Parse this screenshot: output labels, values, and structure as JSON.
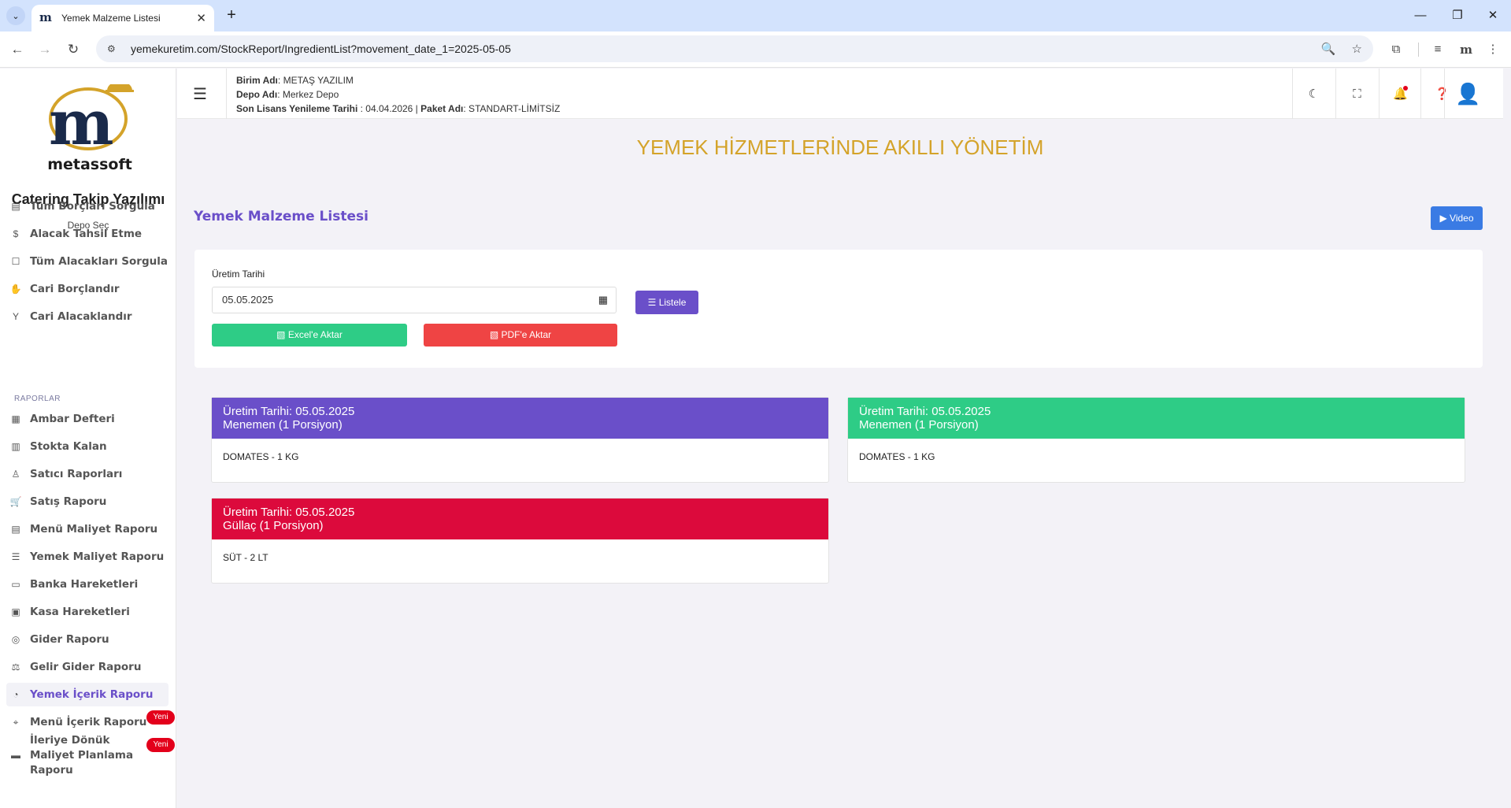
{
  "browser": {
    "tab_title": "Yemek Malzeme Listesi",
    "url": "yemekuretim.com/StockReport/IngredientList?movement_date_1=2025-05-05"
  },
  "sidebar": {
    "brand": "metassoft",
    "subtitle": "Catering Takip Yazılımı",
    "depo_select": "Depo Seç",
    "items_top": [
      {
        "label": "Tüm Borçları Sorgula",
        "icon": "receipt-icon"
      },
      {
        "label": "Alacak Tahsil Etme",
        "icon": "money-icon"
      },
      {
        "label": "Tüm Alacakları Sorgula",
        "icon": "document-icon"
      },
      {
        "label": "Cari Borçlandır",
        "icon": "hand-money-icon"
      },
      {
        "label": "Cari Alacaklandır",
        "icon": "plant-icon"
      }
    ],
    "section_reports": "RAPORLAR",
    "items_reports": [
      {
        "label": "Ambar Defteri",
        "icon": "ledger-icon"
      },
      {
        "label": "Stokta Kalan",
        "icon": "stock-icon"
      },
      {
        "label": "Satıcı Raporları",
        "icon": "seller-icon"
      },
      {
        "label": "Satış Raporu",
        "icon": "cart-icon"
      },
      {
        "label": "Menü Maliyet Raporu",
        "icon": "menu-icon"
      },
      {
        "label": "Yemek Maliyet Raporu",
        "icon": "list-icon"
      },
      {
        "label": "Banka Hareketleri",
        "icon": "bank-icon"
      },
      {
        "label": "Kasa Hareketleri",
        "icon": "cash-register-icon"
      },
      {
        "label": "Gider Raporu",
        "icon": "coins-icon"
      },
      {
        "label": "Gelir Gider Raporu",
        "icon": "balance-icon"
      },
      {
        "label": "Yemek İçerik Raporu",
        "icon": "pie-icon"
      },
      {
        "label": "Menü İçerik Raporu",
        "icon": "tag-icon",
        "badge": "Yeni"
      },
      {
        "label": "İleriye Dönük Maliyet Planlama Raporu",
        "icon": "planning-icon",
        "badge": "Yeni"
      }
    ]
  },
  "header": {
    "birim_label": "Birim Adı",
    "birim_value": ": METAŞ YAZILIM",
    "depo_label": "Depo Adı",
    "depo_value": ": Merkez Depo",
    "license_label": "Son Lisans Yenileme Tarihi",
    "license_value": " : 04.04.2026 | ",
    "package_label": "Paket Adı",
    "package_value": ": STANDART-LİMİTSİZ"
  },
  "main": {
    "slogan": "YEMEK HİZMETLERİNDE AKILLI YÖNETİM",
    "page_title": "Yemek Malzeme Listesi",
    "video_label": "▶ Video",
    "filter": {
      "date_label": "Üretim Tarihi",
      "date_value": "05.05.2025",
      "list_button": "Listele",
      "excel_button": "Excel'e Aktar",
      "pdf_button": "PDF'e Aktar"
    },
    "results": [
      {
        "date_line": "Üretim Tarihi: 05.05.2025",
        "meal": "Menemen (1 Porsiyon)",
        "ingredient": "DOMATES - 1 KG",
        "color": "#6a4fc9"
      },
      {
        "date_line": "Üretim Tarihi: 05.05.2025",
        "meal": "Menemen (1 Porsiyon)",
        "ingredient": "DOMATES - 1 KG",
        "color": "#2ecc86"
      },
      {
        "date_line": "Üretim Tarihi: 05.05.2025",
        "meal": "Güllaç (1 Porsiyon)",
        "ingredient": "SÜT - 2 LT",
        "color": "#dc0a3c"
      }
    ]
  }
}
